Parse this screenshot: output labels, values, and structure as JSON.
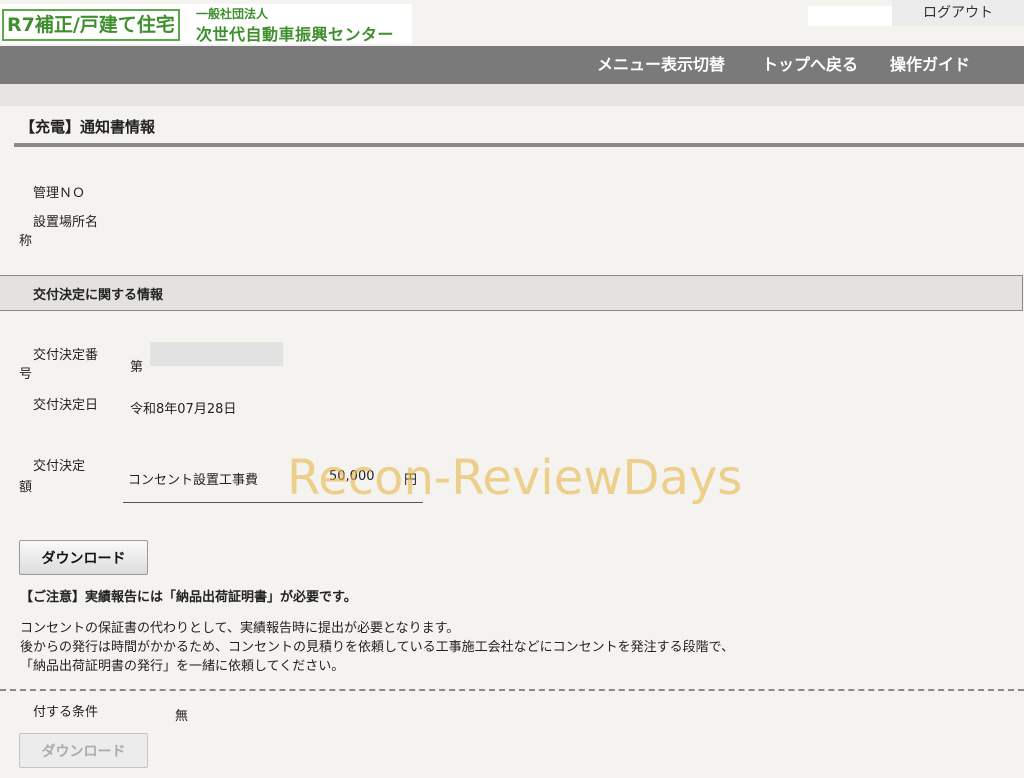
{
  "header": {
    "program_badge": "R7補正/戸建て住宅",
    "org_small": "一般社団法人",
    "org_name": "次世代自動車振興センター",
    "logout": "ログアウト"
  },
  "nav": {
    "menu_toggle": "メニュー表示切替",
    "back_to_top": "トップへ戻る",
    "guide": "操作ガイド"
  },
  "page": {
    "title": "【充電】通知書情報"
  },
  "info": {
    "management_no_label": "管理ＮＯ",
    "site_name_label_1": "設置場所名",
    "site_name_label_2": "称"
  },
  "section": {
    "title": "交付決定に関する情報"
  },
  "decision": {
    "number_label_1": "交付決定番",
    "number_label_2": "号",
    "number_prefix": "第",
    "date_label": "交付決定日",
    "date_value": "令和8年07月28日",
    "amount_label_1": "交付決定",
    "amount_label_2": "額",
    "amount_item": "コンセント設置工事費",
    "amount_value": "50,000",
    "amount_unit": "円"
  },
  "download": {
    "label": "ダウンロード",
    "label_disabled": "ダウンロード"
  },
  "notice": {
    "bold": "【ご注意】実績報告には「納品出荷証明書」が必要です。",
    "line1": "コンセントの保証書の代わりとして、実績報告時に提出が必要となります。",
    "line2": "後からの発行は時間がかかるため、コンセントの見積りを依頼している工事施工会社などにコンセントを発注する段階で、",
    "line3": "「納品出荷証明書の発行」を一緒に依頼してください。"
  },
  "conditions": {
    "label": "付する条件",
    "value": "無"
  },
  "watermark": "Recon-ReviewDays"
}
